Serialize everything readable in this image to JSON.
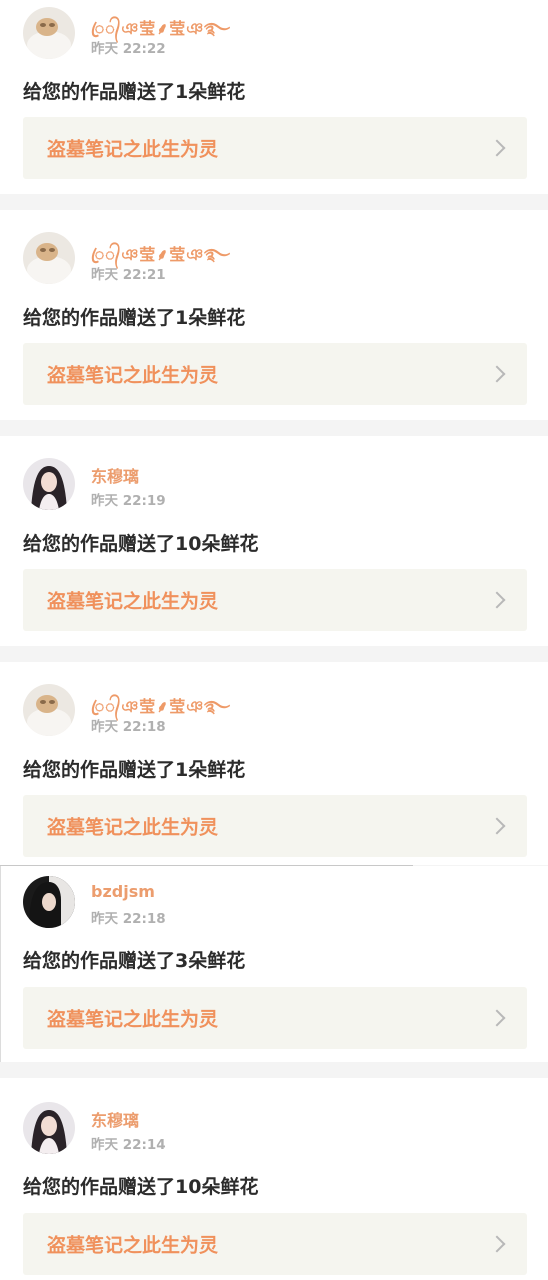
{
  "notifications": [
    {
      "username": "ꦿ᭄ঞ莹⸙莹ঞ࿐",
      "time": "昨天 22:22",
      "message": "给您的作品赠送了1朵鲜花",
      "work_title": "盗墓笔记之此生为灵",
      "avatar": "avatar-cat"
    },
    {
      "username": "ꦿ᭄ঞ莹⸙莹ঞ࿐",
      "time": "昨天 22:21",
      "message": "给您的作品赠送了1朵鲜花",
      "work_title": "盗墓笔记之此生为灵",
      "avatar": "avatar-cat"
    },
    {
      "username": "东穆璃",
      "time": "昨天 22:19",
      "message": "给您的作品赠送了10朵鲜花",
      "work_title": "盗墓笔记之此生为灵",
      "avatar": "avatar-woman"
    },
    {
      "username": "ꦿ᭄ঞ莹⸙莹ঞ࿐",
      "time": "昨天 22:18",
      "message": "给您的作品赠送了1朵鲜花",
      "work_title": "盗墓笔记之此生为灵",
      "avatar": "avatar-cat"
    },
    {
      "username": "bzdjsm",
      "time": "昨天 22:18",
      "message": "给您的作品赠送了3朵鲜花",
      "work_title": "盗墓笔记之此生为灵",
      "avatar": "avatar-dark-hair"
    },
    {
      "username": "东穆璃",
      "time": "昨天 22:14",
      "message": "给您的作品赠送了10朵鲜花",
      "work_title": "盗墓笔记之此生为灵",
      "avatar": "avatar-woman"
    }
  ]
}
